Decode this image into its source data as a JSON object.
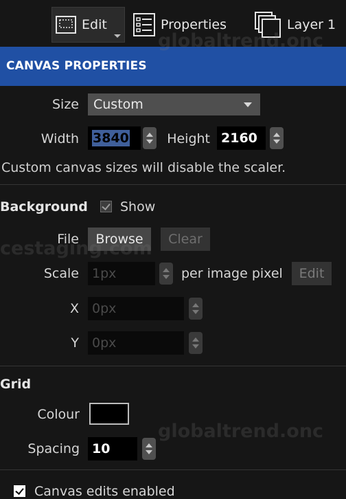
{
  "toolbar": {
    "edit": "Edit",
    "properties": "Properties",
    "layer": "Layer 1"
  },
  "panel": {
    "title": "CANVAS PROPERTIES"
  },
  "size": {
    "label": "Size",
    "value": "Custom"
  },
  "dimensions": {
    "width_label": "Width",
    "width_value": "3840",
    "height_label": "Height",
    "height_value": "2160",
    "note": "Custom canvas sizes will disable the scaler."
  },
  "background": {
    "label": "Background",
    "show_label": "Show",
    "show_checked": true,
    "file_label": "File",
    "browse": "Browse",
    "clear": "Clear",
    "scale_label": "Scale",
    "scale_value": "1px",
    "scale_suffix": "per image pixel",
    "edit": "Edit",
    "x_label": "X",
    "x_value": "0px",
    "y_label": "Y",
    "y_value": "0px"
  },
  "grid": {
    "label": "Grid",
    "colour_label": "Colour",
    "colour_value": "#000000",
    "spacing_label": "Spacing",
    "spacing_value": "10"
  },
  "canvas_edits": {
    "label": "Canvas edits enabled",
    "checked": true
  },
  "watermarks": {
    "a": "globaltrend.onc",
    "b": "cestaging.com",
    "c": "globaltrend.onc"
  },
  "colors": {
    "header": "#2050a4",
    "background": "#161616"
  }
}
